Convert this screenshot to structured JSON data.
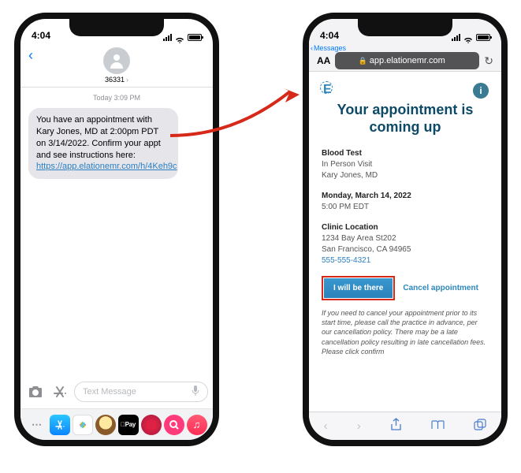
{
  "left": {
    "time": "4:04",
    "sender": "36331",
    "timestamp": "Today 3:09 PM",
    "sms_text": "You have an appointment with Kary Jones, MD at 2:00pm PDT on 3/14/2022. Confirm your appt and see instructions here: ",
    "sms_link": "https://app.elationemr.com/h/4Keh9c",
    "placeholder": "Text Message"
  },
  "right": {
    "time": "4:04",
    "back_label": "Messages",
    "aa": "AA",
    "host": "app.elationemr.com",
    "logo": "E",
    "title": "Your appointment is coming up",
    "appt": {
      "type": "Blood Test",
      "mode": "In Person Visit",
      "doctor": "Kary Jones, MD"
    },
    "when": {
      "date": "Monday, March 14, 2022",
      "time": "5:00 PM EDT"
    },
    "location": {
      "label": "Clinic Location",
      "addr1": "1234 Bay Area St202",
      "addr2": "San Francisco, CA 94965",
      "phone": "555-555-4321"
    },
    "primary_label": "I will be there",
    "cancel_label": "Cancel appointment",
    "policy": "If you need to cancel your appointment prior to its start time, please call the practice in advance, per our cancellation policy. There may be a late cancellation policy resulting in late cancellation fees. Please click confirm"
  }
}
